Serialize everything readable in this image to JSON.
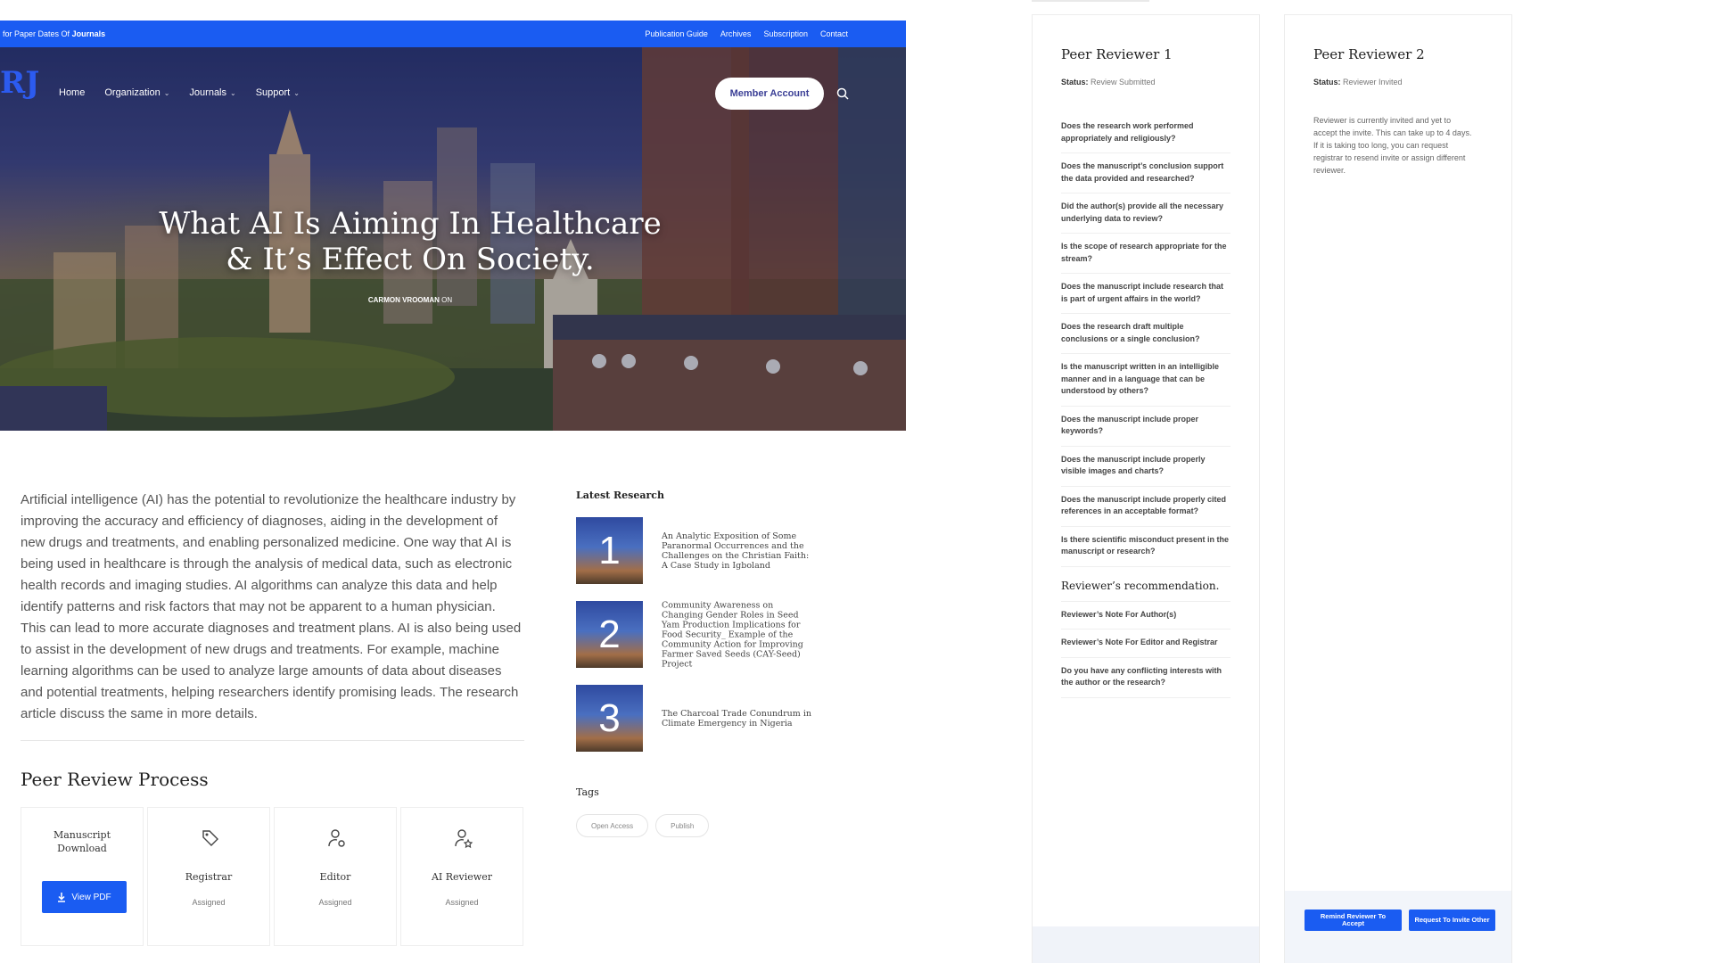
{
  "topbar": {
    "tagline_prefix": "for Paper Dates Of",
    "tagline_bold": "Journals",
    "links": [
      "Publication Guide",
      "Archives",
      "Subscription",
      "Contact"
    ]
  },
  "hero": {
    "logo": "RJ",
    "nav": [
      {
        "label": "Home",
        "caret": ""
      },
      {
        "label": "Organization",
        "caret": "⌄"
      },
      {
        "label": "Journals",
        "caret": "⌄"
      },
      {
        "label": "Support",
        "caret": "⌄"
      }
    ],
    "member_button": "Member Account",
    "title": "What AI Is Aiming In Healthcare & It’s Effect On Society.",
    "byline_author": "CARMON VROOMAN",
    "byline_suffix": "ON"
  },
  "article": {
    "body": "Artificial intelligence (AI) has the potential to revolutionize the healthcare industry by improving the accuracy and efficiency of diagnoses, aiding in the development of new drugs and treatments, and enabling personalized medicine. One way that AI is being used in healthcare is through the analysis of medical data, such as electronic health records and imaging studies. AI algorithms can analyze this data and help identify patterns and risk factors that may not be apparent to a human physician. This can lead to more accurate diagnoses and treatment plans. AI is also being used to assist in the development of new drugs and treatments. For example, machine learning algorithms can be used to analyze large amounts of data about diseases and potential treatments, helping researchers identify promising leads. The research article discuss the same in more details."
  },
  "peer_review_process": {
    "title": "Peer Review Process",
    "manuscript_label": "Manuscript Download",
    "view_pdf": "View PDF",
    "roles": [
      {
        "label": "Registrar",
        "status": "Assigned",
        "icon": "tag-icon"
      },
      {
        "label": "Editor",
        "status": "Assigned",
        "icon": "user-settings-icon"
      },
      {
        "label": "AI Reviewer",
        "status": "Assigned",
        "icon": "user-star-icon"
      }
    ]
  },
  "latest_research": {
    "title": "Latest Research",
    "items": [
      {
        "num": "1",
        "title": "An Analytic Exposition of Some Paranormal Occurrences and the Challenges on the Christian Faith: A Case Study in Igboland"
      },
      {
        "num": "2",
        "title": "Community Awareness on Changing Gender Roles in Seed Yam Production Implications for Food Security_ Example of the Community Action for Improving Farmer Saved Seeds (CAY-Seed) Project"
      },
      {
        "num": "3",
        "title": "The Charcoal Trade Conundrum in Climate Emergency in Nigeria"
      }
    ]
  },
  "tags": {
    "title": "Tags",
    "items": [
      "Open Access",
      "Publish"
    ]
  },
  "reviewer1": {
    "title": "Peer Reviewer 1",
    "status_label": "Status:",
    "status_value": "Review Submitted",
    "questions": [
      "Does the research work performed appropriately and religiously?",
      "Does the manuscript’s conclusion support the data provided and researched?",
      "Did the author(s) provide all the necessary underlying data to review?",
      "Is the scope of research appropriate for the stream?",
      "Does the manuscript include research that is part of urgent affairs in the world?",
      "Does the research draft multiple conclusions or a single conclusion?",
      "Is the manuscript written in an intelligible manner and in a language that can be understood by others?",
      "Does the manuscript include proper keywords?",
      "Does the manuscript include properly visible images and charts?",
      "Does the manuscript include properly cited references in an acceptable format?",
      "Is there scientific misconduct present in the manuscript or research?"
    ],
    "recommendation_title": "Reviewer’s recommendation.",
    "notes": [
      "Reviewer’s Note For Author(s)",
      "Reviewer’s Note For Editor and Registrar",
      "Do you have any conflicting interests with the author or the research?"
    ]
  },
  "reviewer2": {
    "title": "Peer Reviewer 2",
    "status_label": "Status:",
    "status_value": "Reviewer Invited",
    "note": "Reviewer is currently invited and yet to accept the invite. This can take up to 4 days. If it is taking too long, you can request registrar to resend invite or assign different reviewer.",
    "remind_button": "Remind Reviewer To Accept",
    "invite_other_button": "Request To Invite Other"
  },
  "colors": {
    "brand_blue": "#1a5cf2",
    "member_text": "#3b3f96"
  }
}
